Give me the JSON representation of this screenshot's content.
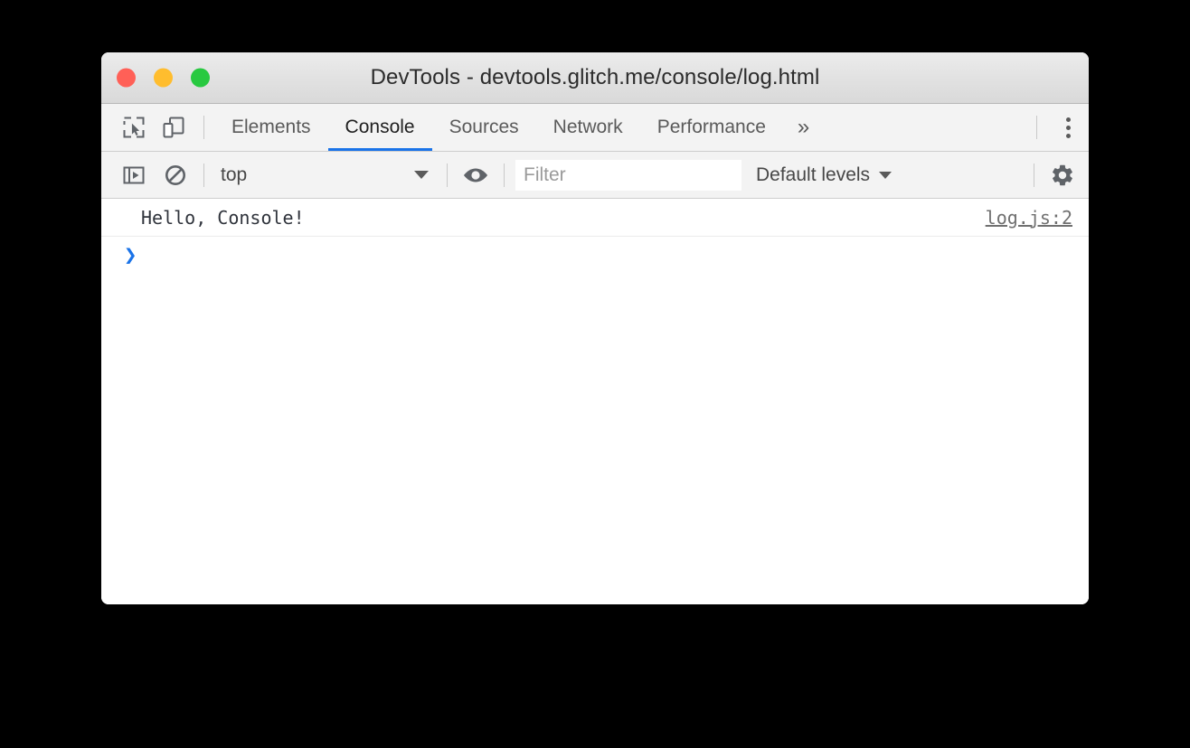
{
  "window": {
    "title": "DevTools - devtools.glitch.me/console/log.html",
    "traffic_lights": [
      {
        "name": "close",
        "color": "#ff6057"
      },
      {
        "name": "minimize",
        "color": "#ffbd2e"
      },
      {
        "name": "zoom",
        "color": "#28c940"
      }
    ]
  },
  "tabbar": {
    "inspect_icon": "inspect-element-icon",
    "device_icon": "device-toolbar-icon",
    "tabs": [
      {
        "label": "Elements",
        "active": false
      },
      {
        "label": "Console",
        "active": true
      },
      {
        "label": "Sources",
        "active": false
      },
      {
        "label": "Network",
        "active": false
      },
      {
        "label": "Performance",
        "active": false
      }
    ],
    "more_tabs_label": "»",
    "menu_icon": "vertical-dots-icon",
    "active_underline_color": "#1a73e8"
  },
  "console_toolbar": {
    "sidebar_icon": "console-sidebar-icon",
    "clear_icon": "clear-console-icon",
    "context": {
      "value": "top",
      "caret_icon": "chevron-down-icon"
    },
    "eye_icon": "live-expression-eye-icon",
    "filter": {
      "value": "",
      "placeholder": "Filter"
    },
    "levels": {
      "label": "Default levels",
      "caret_icon": "chevron-down-icon"
    },
    "settings_icon": "gear-icon"
  },
  "console": {
    "messages": [
      {
        "text": "Hello, Console!",
        "source": "log.js:2"
      }
    ],
    "prompt": {
      "caret": "❯",
      "value": "",
      "placeholder": ""
    }
  },
  "colors": {
    "accent": "#1a73e8",
    "toolbar_bg": "#f3f3f3",
    "titlebar_bg": "#e6e6e6",
    "page_bg": "#000000",
    "message_text": "#30343c",
    "source_link": "#707070"
  }
}
